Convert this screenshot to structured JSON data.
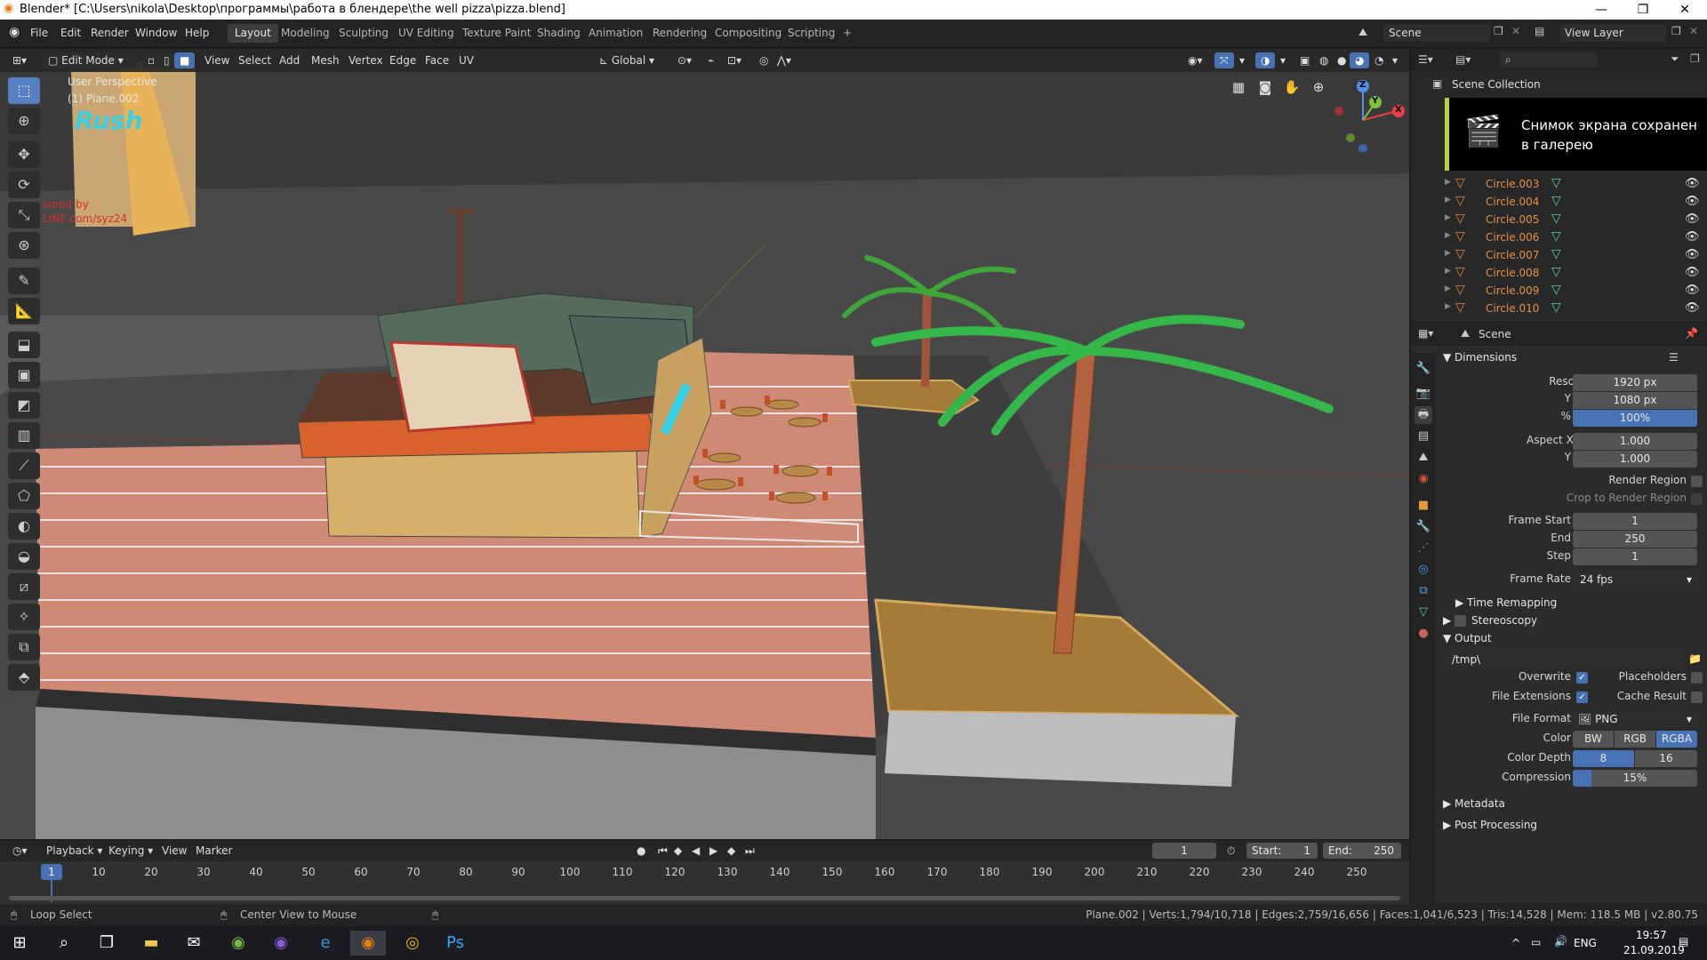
{
  "window": {
    "title": "Blender* [C:\\Users\\nikola\\Desktop\\программы\\работа в блендере\\the well pizza\\pizza.blend]",
    "minimize": "—",
    "maximize": "❐",
    "close": "✕"
  },
  "menu": [
    "File",
    "Edit",
    "Render",
    "Window",
    "Help"
  ],
  "workspaces": [
    "Layout",
    "Modeling",
    "Sculpting",
    "UV Editing",
    "Texture Paint",
    "Shading",
    "Animation",
    "Rendering",
    "Compositing",
    "Scripting",
    "+"
  ],
  "scene_field": "Scene",
  "view_layer_field": "View Layer",
  "viewport": {
    "mode": "Edit Mode",
    "header_menus": [
      "View",
      "Select",
      "Add",
      "Mesh",
      "Vertex",
      "Edge",
      "Face",
      "UV"
    ],
    "orientation": "Global",
    "overlay_line1": "User Perspective",
    "overlay_line2": "(1) Plane.002",
    "ref_text1": "Rush",
    "ref_text2": "sored by",
    "ref_text3": "LINE.com/syz24",
    "gizmo": {
      "x": "X",
      "y": "Y",
      "z": "Z"
    }
  },
  "outliner": {
    "root": "Scene Collection",
    "rows": [
      "Circle.003",
      "Circle.004",
      "Circle.005",
      "Circle.006",
      "Circle.007",
      "Circle.008",
      "Circle.009",
      "Circle.010"
    ]
  },
  "toast": {
    "line1": "Снимок экрана сохранен",
    "line2": "в галерею"
  },
  "props": {
    "context": "Scene",
    "dimensions": {
      "title": "Dimensions",
      "res_x_label": "Resolution X",
      "res_x": "1920 px",
      "res_y_label": "Y",
      "res_y": "1080 px",
      "pct_label": "%",
      "pct": "100%",
      "aspect_x_label": "Aspect X",
      "aspect_x": "1.000",
      "aspect_y_label": "Y",
      "aspect_y": "1.000",
      "render_region": "Render Region",
      "crop": "Crop to Render Region",
      "frame_start_label": "Frame Start",
      "frame_start": "1",
      "end_label": "End",
      "end": "250",
      "step_label": "Step",
      "step": "1",
      "frame_rate_label": "Frame Rate",
      "frame_rate": "24 fps",
      "time_remapping": "Time Remapping"
    },
    "stereoscopy": "Stereoscopy",
    "output": {
      "title": "Output",
      "path": "/tmp\\",
      "overwrite": "Overwrite",
      "placeholders": "Placeholders",
      "file_ext": "File Extensions",
      "cache_result": "Cache Result",
      "file_format_label": "File Format",
      "file_format": "PNG",
      "color_label": "Color",
      "color_opts": [
        "BW",
        "RGB",
        "RGBA"
      ],
      "depth_label": "Color Depth",
      "depth_opts": [
        "8",
        "16"
      ],
      "compression_label": "Compression",
      "compression": "15%"
    },
    "metadata": "Metadata",
    "post_processing": "Post Processing"
  },
  "timeline": {
    "menus": [
      "Playback",
      "Keying",
      "View",
      "Marker"
    ],
    "current_frame": "1",
    "start_label": "Start:",
    "start": "1",
    "end_label": "End:",
    "end": "250",
    "ticks": [
      "1",
      "10",
      "20",
      "30",
      "40",
      "50",
      "60",
      "70",
      "80",
      "90",
      "100",
      "110",
      "120",
      "130",
      "140",
      "150",
      "160",
      "170",
      "180",
      "190",
      "200",
      "210",
      "220",
      "230",
      "240",
      "250"
    ]
  },
  "status": {
    "left": "Loop Select",
    "middle": "Center View to Mouse",
    "right": "Plane.002 | Verts:1,794/10,718 | Edges:2,759/16,656 | Faces:1,041/6,523 | Tris:14,528 | Mem: 118.5 MB | v2.80.75"
  },
  "taskbar": {
    "lang": "ENG",
    "time": "19:57",
    "date": "21.09.2019"
  },
  "colors": {
    "accent": "#4772b3",
    "object_orange": "#e8914a",
    "active_ws": "#3d3d3d"
  }
}
